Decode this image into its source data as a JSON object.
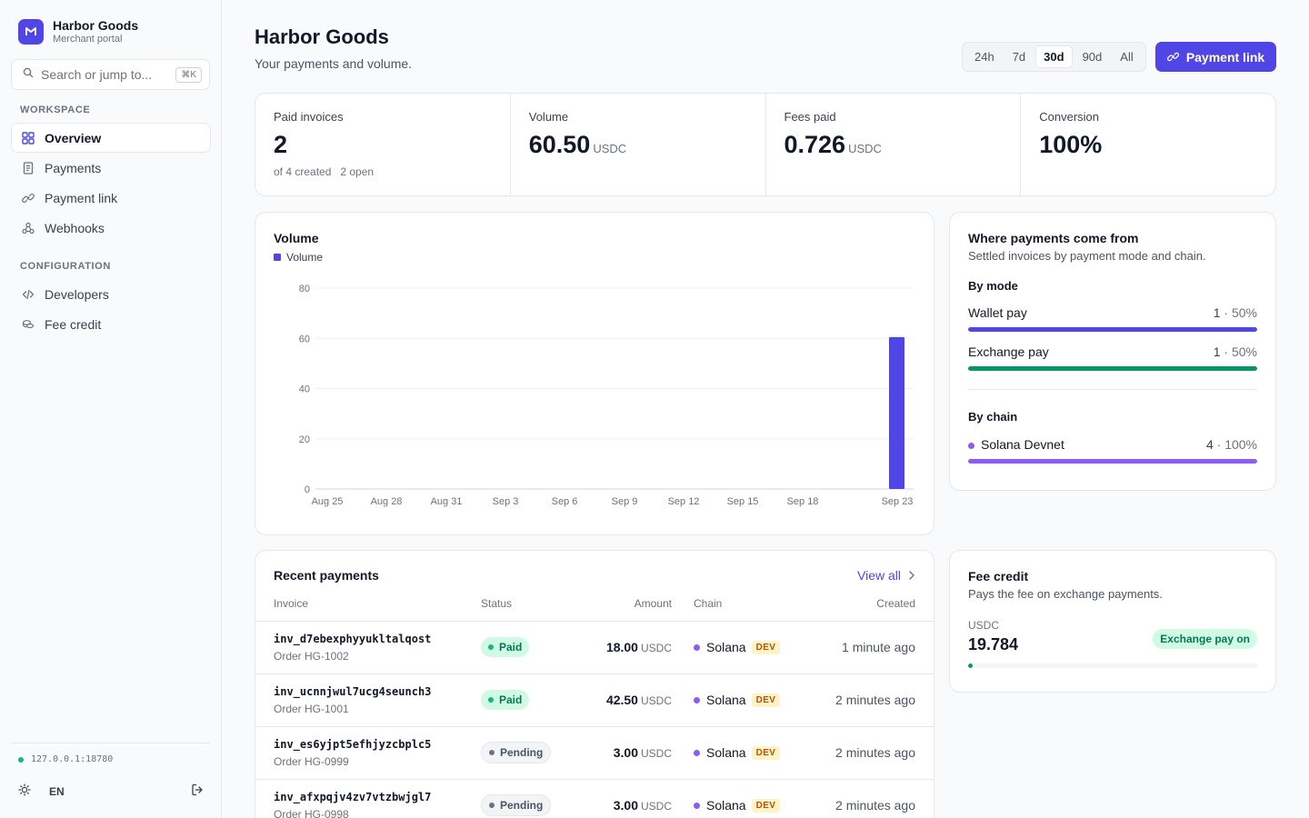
{
  "brand": {
    "name": "Harbor Goods",
    "subtitle": "Merchant portal"
  },
  "search": {
    "placeholder": "Search or jump to...",
    "shortcut": "⌘K"
  },
  "sidebar": {
    "workspace_label": "WORKSPACE",
    "workspace_items": [
      {
        "label": "Overview",
        "icon": "grid-icon",
        "active": true
      },
      {
        "label": "Payments",
        "icon": "receipt-icon"
      },
      {
        "label": "Payment link",
        "icon": "link-icon"
      },
      {
        "label": "Webhooks",
        "icon": "webhook-icon"
      }
    ],
    "config_label": "CONFIGURATION",
    "config_items": [
      {
        "label": "Developers",
        "icon": "code-icon"
      },
      {
        "label": "Fee credit",
        "icon": "coins-icon"
      }
    ],
    "env": "127.0.0.1:18780",
    "lang": "EN"
  },
  "header": {
    "title": "Harbor Goods",
    "subtitle": "Your payments and volume.",
    "ranges": [
      "24h",
      "7d",
      "30d",
      "90d",
      "All"
    ],
    "active_range": "30d",
    "payment_link_label": "Payment link"
  },
  "stats": [
    {
      "label": "Paid invoices",
      "value": "2",
      "unit": "",
      "sub1": "of 4 created",
      "sub2": "2 open"
    },
    {
      "label": "Volume",
      "value": "60.50",
      "unit": "USDC",
      "sub1": "",
      "sub2": ""
    },
    {
      "label": "Fees paid",
      "value": "0.726",
      "unit": "USDC",
      "sub1": "",
      "sub2": ""
    },
    {
      "label": "Conversion",
      "value": "100%",
      "unit": "",
      "sub1": "",
      "sub2": ""
    }
  ],
  "volume_card": {
    "title": "Volume",
    "legend": "Volume"
  },
  "chart_data": {
    "type": "bar",
    "title": "Volume",
    "x_ticks": [
      "Aug 25",
      "Aug 28",
      "Aug 31",
      "Sep 3",
      "Sep 6",
      "Sep 9",
      "Sep 12",
      "Sep 15",
      "Sep 18",
      "Sep 23"
    ],
    "y_ticks": [
      0,
      20,
      40,
      60,
      80
    ],
    "ylim": [
      0,
      80
    ],
    "series": [
      {
        "name": "Volume",
        "color": "#4f46e5",
        "points": [
          {
            "x": "Sep 23",
            "y": 60.5
          }
        ]
      }
    ],
    "grid": true,
    "legend_position": "top-left"
  },
  "sources": {
    "title": "Where payments come from",
    "desc": "Settled invoices by payment mode and chain.",
    "by_mode_label": "By mode",
    "modes": [
      {
        "label": "Wallet pay",
        "count": "1",
        "pct": "50%",
        "fraction": 1.0,
        "color": "#4f46e5"
      },
      {
        "label": "Exchange pay",
        "count": "1",
        "pct": "50%",
        "fraction": 1.0,
        "color": "#059669"
      }
    ],
    "by_chain_label": "By chain",
    "chains": [
      {
        "label": "Solana Devnet",
        "count": "4",
        "pct": "100%",
        "fraction": 1.0,
        "color": "#8b5cf6"
      }
    ]
  },
  "recent": {
    "title": "Recent payments",
    "view_all": "View all",
    "columns": [
      "Invoice",
      "Status",
      "Amount",
      "Chain",
      "Created"
    ],
    "rows": [
      {
        "id": "inv_d7ebexphyyukltalqost",
        "order": "Order HG-1002",
        "status": "Paid",
        "amount": "18.00",
        "unit": "USDC",
        "chain": "Solana",
        "tag": "DEV",
        "created": "1 minute ago"
      },
      {
        "id": "inv_ucnnjwul7ucg4seunch3",
        "order": "Order HG-1001",
        "status": "Paid",
        "amount": "42.50",
        "unit": "USDC",
        "chain": "Solana",
        "tag": "DEV",
        "created": "2 minutes ago"
      },
      {
        "id": "inv_es6yjpt5efhjyzcbplc5",
        "order": "Order HG-0999",
        "status": "Pending",
        "amount": "3.00",
        "unit": "USDC",
        "chain": "Solana",
        "tag": "DEV",
        "created": "2 minutes ago"
      },
      {
        "id": "inv_afxpqjv4zv7vtzbwjgl7",
        "order": "Order HG-0998",
        "status": "Pending",
        "amount": "3.00",
        "unit": "USDC",
        "chain": "Solana",
        "tag": "DEV",
        "created": "2 minutes ago"
      }
    ]
  },
  "fee_credit": {
    "title": "Fee credit",
    "desc": "Pays the fee on exchange payments.",
    "unit": "USDC",
    "value": "19.784",
    "badge": "Exchange pay on",
    "level": 0.015
  }
}
